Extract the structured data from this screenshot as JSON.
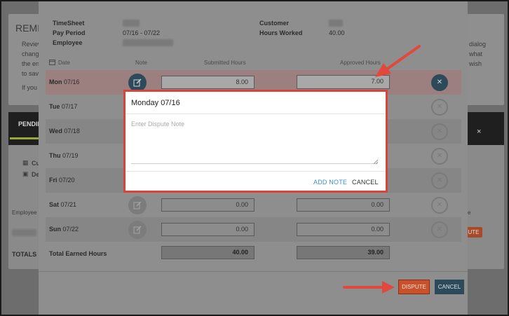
{
  "background": {
    "heading": "REMI",
    "para_lines": [
      "Review",
      "change",
      "the en",
      "to sav"
    ],
    "if_you": "If you",
    "right_lines": [
      "dialog",
      "what",
      "wish"
    ],
    "pending_tab": "PENDIN",
    "close_x": "×",
    "item_cu": "Cu",
    "item_de": "De",
    "employee_label": "Employee N",
    "totals_label": "TOTALS",
    "right_e": "e",
    "right_pill": "UTE"
  },
  "timesheet": {
    "labels": {
      "timesheet": "TimeSheet",
      "pay_period": "Pay Period",
      "employee": "Employee",
      "customer": "Customer",
      "hours_worked": "Hours Worked"
    },
    "pay_period": "07/16 - 07/22",
    "hours_worked": "40.00"
  },
  "columns": {
    "date": "Date",
    "note": "Note",
    "submitted": "Submitted Hours",
    "approved": "Approved Hours"
  },
  "rows": [
    {
      "day": "Mon",
      "date": "07/16",
      "submitted": "8.00",
      "approved": "7.00"
    },
    {
      "day": "Tue",
      "date": "07/17",
      "submitted": "",
      "approved": ""
    },
    {
      "day": "Wed",
      "date": "07/18",
      "submitted": "",
      "approved": ""
    },
    {
      "day": "Thu",
      "date": "07/19",
      "submitted": "",
      "approved": ""
    },
    {
      "day": "Fri",
      "date": "07/20",
      "submitted": "",
      "approved": ""
    },
    {
      "day": "Sat",
      "date": "07/21",
      "submitted": "0.00",
      "approved": "0.00"
    },
    {
      "day": "Sun",
      "date": "07/22",
      "submitted": "0.00",
      "approved": "0.00"
    }
  ],
  "totals": {
    "label": "Total Earned Hours",
    "submitted": "40.00",
    "approved": "39.00"
  },
  "actions": {
    "dispute": "DISPUTE",
    "cancel": "CANCEL"
  },
  "dialog": {
    "title": "Monday 07/16",
    "placeholder": "Enter Dispute Note",
    "add_note": "ADD NOTE",
    "cancel": "CANCEL"
  },
  "icons": {
    "note": "edit-note-icon",
    "remove": "circle-x-icon",
    "calendar": "calendar-icon",
    "building": "building-icon",
    "briefcase": "briefcase-icon"
  },
  "colors": {
    "accent_red": "#d9443a",
    "dispute_orange": "#c8502a",
    "teal": "#2d4a5a",
    "link_blue": "#3a8fd0"
  }
}
